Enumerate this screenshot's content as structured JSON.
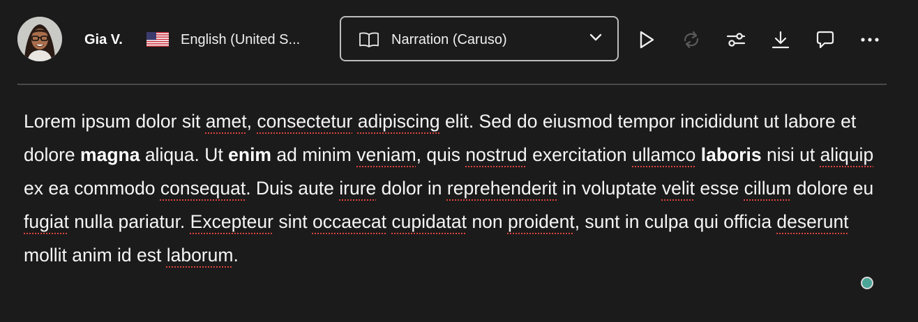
{
  "user": {
    "name": "Gia V.",
    "language": "English (United S..."
  },
  "voice": {
    "selected": "Narration (Caruso)"
  },
  "icons": {
    "play": "play-icon",
    "regenerate": "refresh-icon",
    "settings": "sliders-icon",
    "download": "download-icon",
    "comment": "comment-icon",
    "more": "more-icon"
  },
  "colors": {
    "background": "#1b1b1b",
    "status_dot": "#4aa597",
    "spell_underline": "#e0443e"
  },
  "text": [
    {
      "t": "Lorem ipsum dolor sit "
    },
    {
      "t": "amet",
      "s": true
    },
    {
      "t": ", "
    },
    {
      "t": "consectetur",
      "s": true
    },
    {
      "t": " "
    },
    {
      "t": "adipiscing",
      "s": true
    },
    {
      "t": " elit. Sed do eiusmod tempor incididunt ut labore et dolore "
    },
    {
      "t": "magna",
      "b": true
    },
    {
      "t": " aliqua. Ut "
    },
    {
      "t": "enim",
      "b": true
    },
    {
      "t": " ad minim "
    },
    {
      "t": "veniam",
      "s": true
    },
    {
      "t": ", quis "
    },
    {
      "t": "nostrud",
      "s": true
    },
    {
      "t": " exercitation "
    },
    {
      "t": "ullamco",
      "s": true
    },
    {
      "t": " "
    },
    {
      "t": "laboris",
      "b": true
    },
    {
      "t": " nisi ut "
    },
    {
      "t": "aliquip",
      "s": true
    },
    {
      "t": " ex ea commodo "
    },
    {
      "t": "consequat",
      "s": true
    },
    {
      "t": ". Duis aute "
    },
    {
      "t": "irure",
      "s": true
    },
    {
      "t": " dolor in "
    },
    {
      "t": "reprehenderit",
      "s": true
    },
    {
      "t": " in voluptate "
    },
    {
      "t": "velit",
      "s": true
    },
    {
      "t": " esse "
    },
    {
      "t": "cillum",
      "s": true
    },
    {
      "t": " dolore eu "
    },
    {
      "t": "fugiat",
      "s": true
    },
    {
      "t": " nulla pariatur. "
    },
    {
      "t": "Excepteur",
      "s": true
    },
    {
      "t": " sint "
    },
    {
      "t": "occaecat",
      "s": true
    },
    {
      "t": " "
    },
    {
      "t": "cupidatat",
      "s": true
    },
    {
      "t": " non "
    },
    {
      "t": "proident",
      "s": true
    },
    {
      "t": ", sunt in culpa qui officia "
    },
    {
      "t": "deserunt",
      "s": true
    },
    {
      "t": " mollit anim id est "
    },
    {
      "t": "laborum",
      "s": true
    },
    {
      "t": "."
    }
  ]
}
